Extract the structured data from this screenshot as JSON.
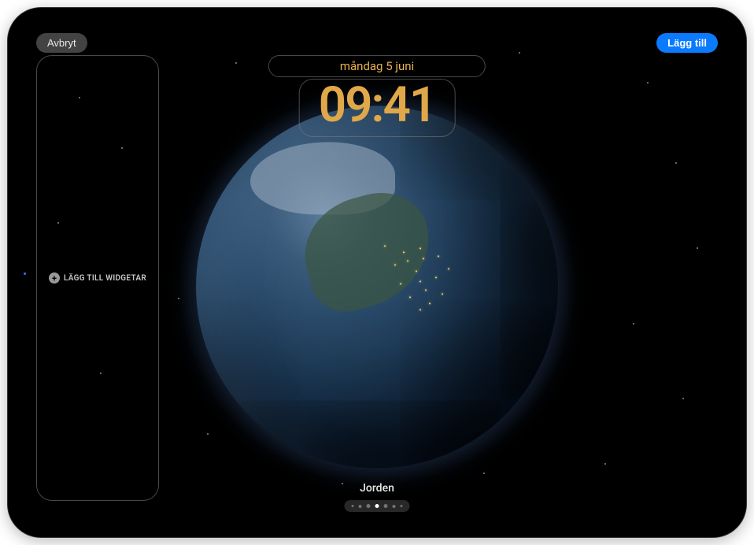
{
  "buttons": {
    "cancel": "Avbryt",
    "add": "Lägg till"
  },
  "lockscreen": {
    "date": "måndag 5 juni",
    "time": "09:41",
    "wallpaper_name": "Jorden"
  },
  "widget_panel": {
    "add_label": "LÄGG TILL WIDGETAR"
  },
  "pager": {
    "total": 7,
    "active_index": 3
  },
  "colors": {
    "accent_date": "#e8b050",
    "accent_time": "#e0a848",
    "add_button": "#0a7aff"
  }
}
